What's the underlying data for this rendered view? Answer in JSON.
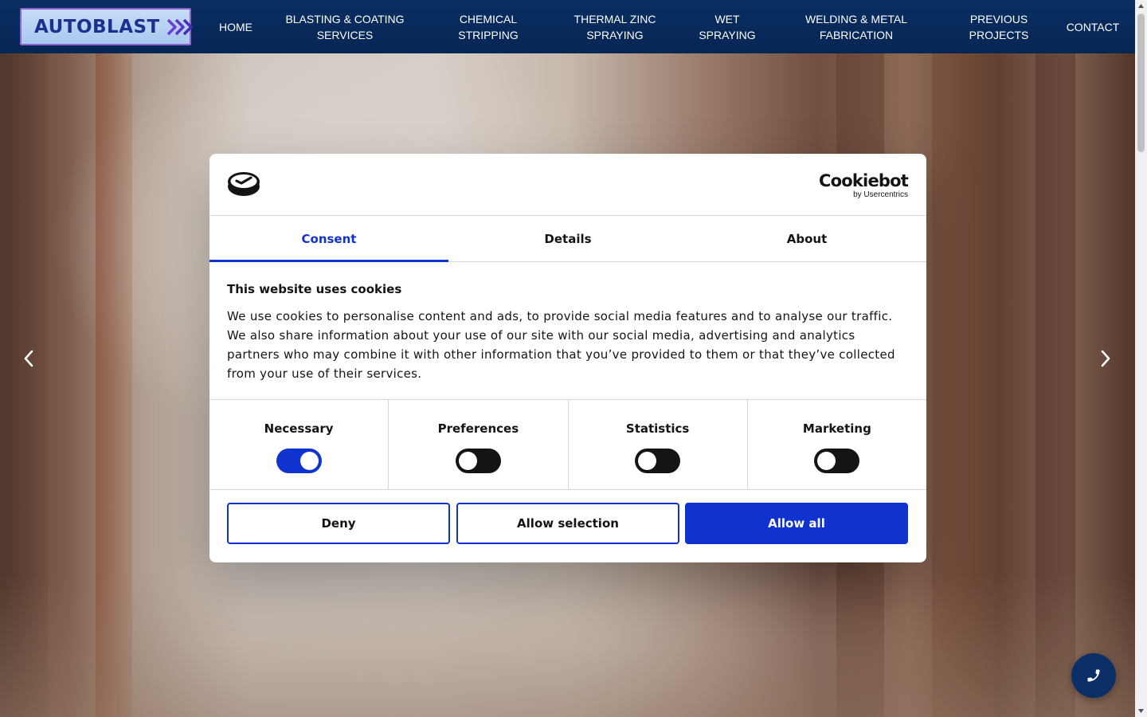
{
  "brand": {
    "logo_text": "AUTOBLAST"
  },
  "nav": {
    "items": [
      {
        "line1": "HOME",
        "line2": ""
      },
      {
        "line1": "BLASTING & COATING",
        "line2": "SERVICES"
      },
      {
        "line1": "CHEMICAL",
        "line2": "STRIPPING"
      },
      {
        "line1": "THERMAL ZINC",
        "line2": "SPRAYING"
      },
      {
        "line1": "WET",
        "line2": "SPRAYING"
      },
      {
        "line1": "WELDING & METAL",
        "line2": "FABRICATION"
      },
      {
        "line1": "PREVIOUS",
        "line2": "PROJECTS"
      },
      {
        "line1": "CONTACT",
        "line2": ""
      }
    ]
  },
  "cookie_dialog": {
    "brand_name": "Cookiebot",
    "brand_sub": "by Usercentrics",
    "tabs": [
      {
        "label": "Consent",
        "active": true
      },
      {
        "label": "Details",
        "active": false
      },
      {
        "label": "About",
        "active": false
      }
    ],
    "title": "This website uses cookies",
    "description": "We use cookies to personalise content and ads, to provide social media features and to analyse our traffic. We also share information about your use of our site with our social media, advertising and analytics partners who may combine it with other information that you’ve provided to them or that they’ve collected from your use of their services.",
    "preferences": [
      {
        "label": "Necessary",
        "enabled": true
      },
      {
        "label": "Preferences",
        "enabled": false
      },
      {
        "label": "Statistics",
        "enabled": false
      },
      {
        "label": "Marketing",
        "enabled": false
      }
    ],
    "buttons": {
      "deny": "Deny",
      "allow_selection": "Allow selection",
      "allow_all": "Allow all"
    }
  },
  "colors": {
    "nav_bg": "#0a2e63",
    "accent": "#1032cf",
    "logo_text": "#1d2f8f",
    "logo_border": "#8d63d1"
  },
  "icons": {
    "logo_arrows": "triple-chevron-right-icon",
    "slider_prev": "chevron-left-icon",
    "slider_next": "chevron-right-icon",
    "call": "phone-icon"
  }
}
